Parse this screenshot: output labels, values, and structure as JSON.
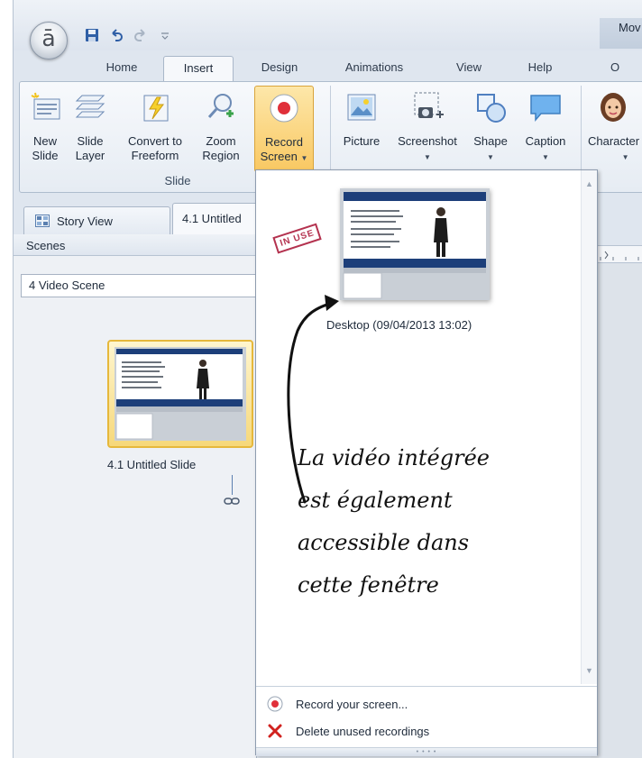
{
  "app": {
    "title": "Mov",
    "app_button_letter": "ā"
  },
  "tabs": [
    {
      "label": "Home"
    },
    {
      "label": "Insert",
      "active": true
    },
    {
      "label": "Design"
    },
    {
      "label": "Animations"
    },
    {
      "label": "View"
    },
    {
      "label": "Help"
    },
    {
      "label": "O"
    }
  ],
  "ribbon": {
    "slide_group": {
      "label": "Slide",
      "buttons": [
        {
          "label_line1": "New",
          "label_line2": "Slide",
          "icon": "new-slide-icon"
        },
        {
          "label_line1": "Slide",
          "label_line2": "Layer",
          "icon": "slide-layer-icon"
        },
        {
          "label_line1": "Convert to",
          "label_line2": "Freeform",
          "icon": "convert-freeform-icon"
        },
        {
          "label_line1": "Zoom",
          "label_line2": "Region",
          "icon": "zoom-region-icon"
        },
        {
          "label_line1": "Record",
          "label_line2": "Screen",
          "icon": "record-icon",
          "pressed": true
        }
      ]
    },
    "insert_group": {
      "buttons": [
        {
          "label": "Picture",
          "icon": "picture-icon"
        },
        {
          "label": "Screenshot",
          "icon": "screenshot-icon"
        },
        {
          "label": "Shape",
          "icon": "shape-icon"
        },
        {
          "label": "Caption",
          "icon": "caption-icon"
        },
        {
          "label": "Character",
          "icon": "character-icon"
        }
      ]
    }
  },
  "left_panel": {
    "story_tab": "Story View",
    "doc_tab": "4.1 Untitled",
    "scenes_header": "Scenes",
    "scene_select": "4 Video Scene",
    "slide_label": "4.1 Untitled Slide"
  },
  "dropdown": {
    "stamp": "IN USE",
    "recording_caption": "Desktop (09/04/2013 13:02)",
    "annotation_lines": [
      "La vidéo intégrée",
      "est également",
      "accessible dans",
      "cette fenêtre"
    ],
    "items": [
      {
        "label": "Record your screen...",
        "icon": "record-icon"
      },
      {
        "label": "Delete unused recordings",
        "icon": "delete-x-icon"
      }
    ]
  },
  "colors": {
    "accent_record": "#e0303a",
    "ribbon_pressed": "#f9c862",
    "selection_border": "#e6b83b",
    "stamp": "#b4324f"
  }
}
